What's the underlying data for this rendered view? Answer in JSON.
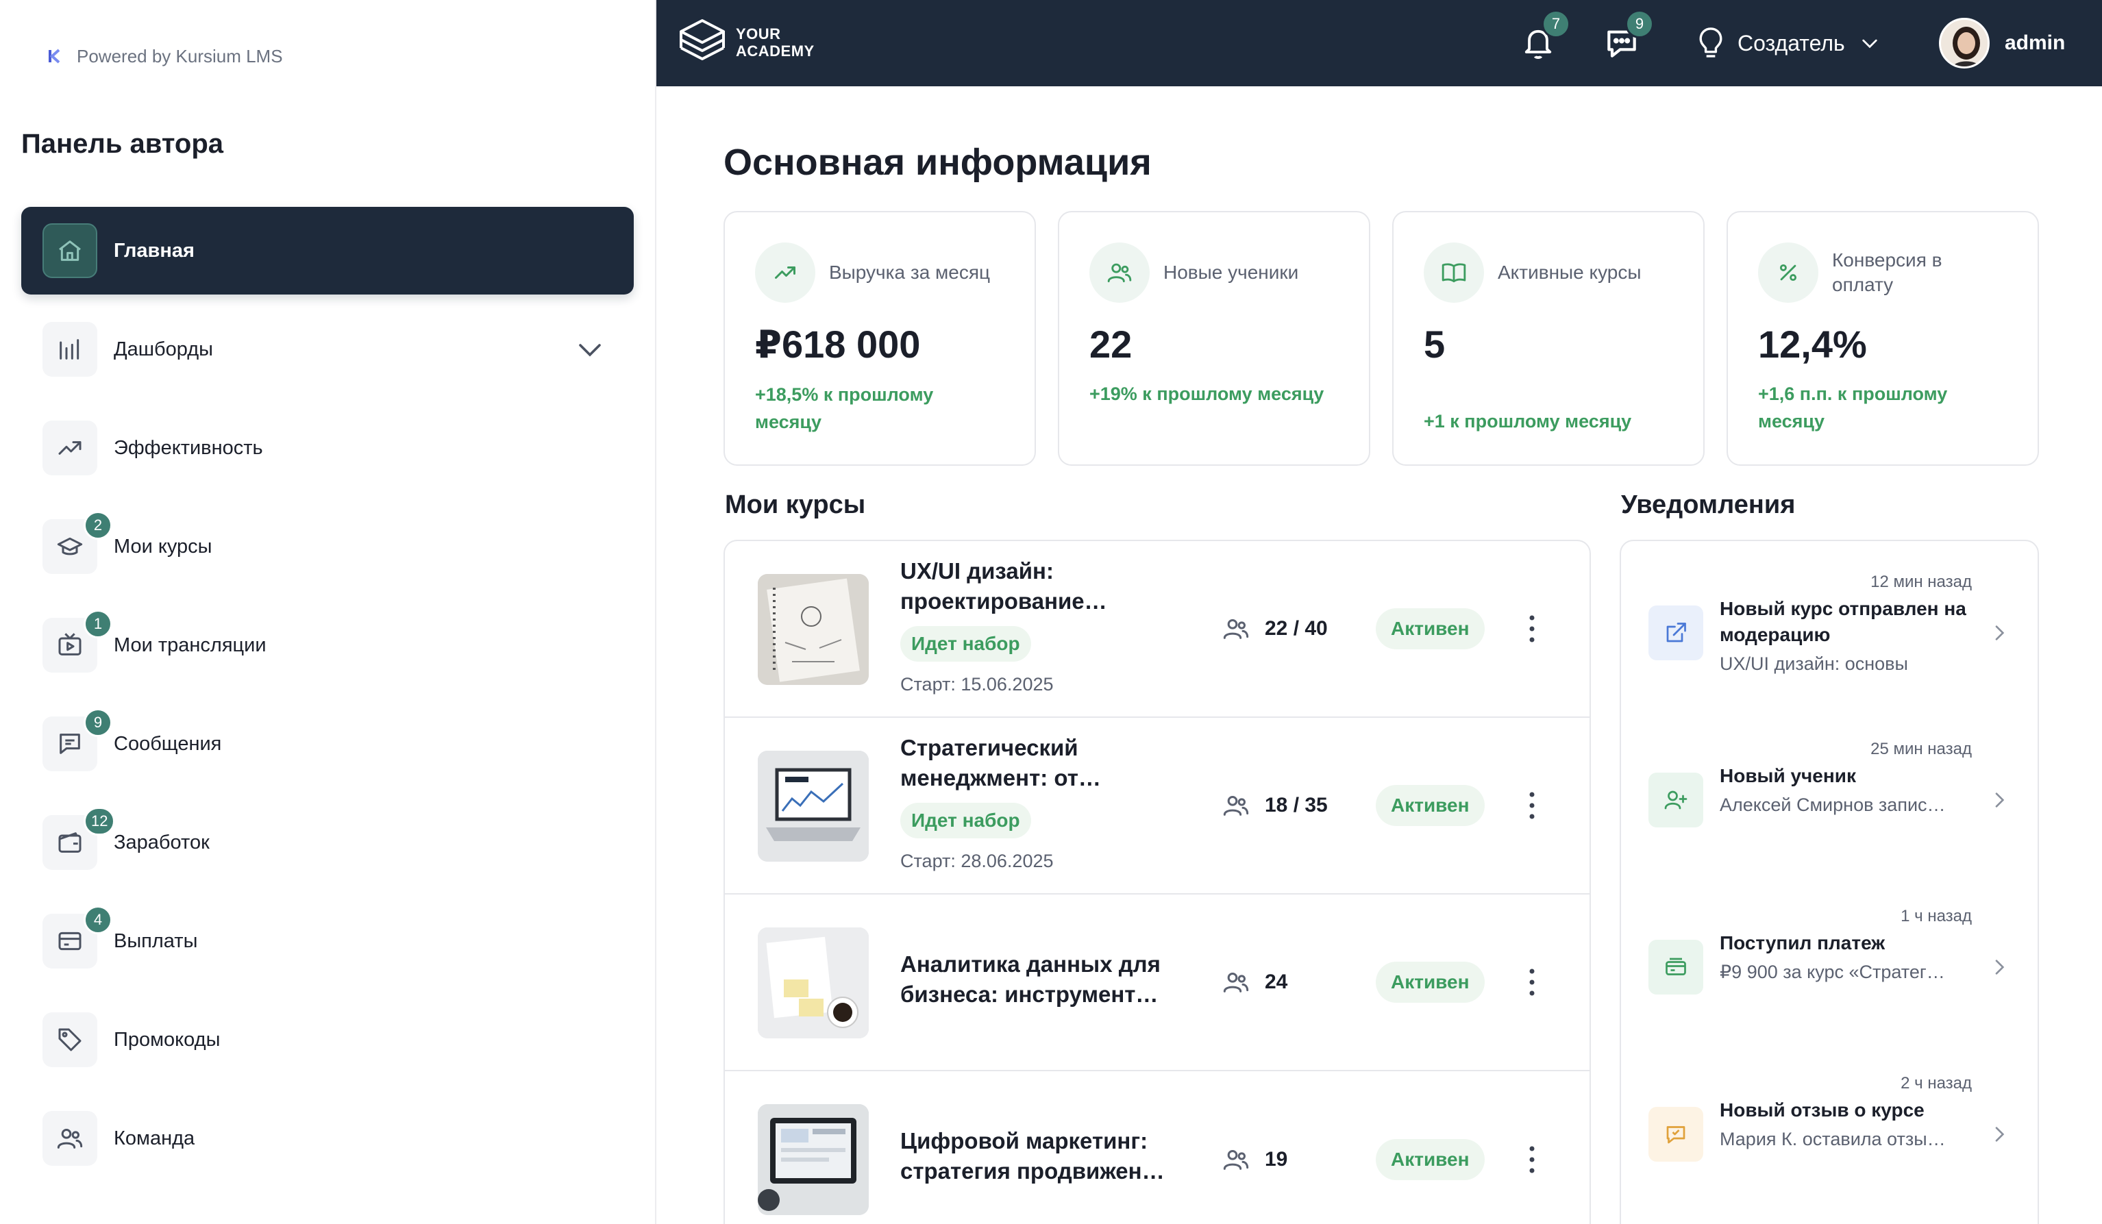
{
  "sidebar": {
    "powered_by": "Powered by Kursium LMS",
    "panel_title": "Панель автора",
    "items": [
      {
        "label": "Главная",
        "badge": ""
      },
      {
        "label": "Дашборды",
        "badge": ""
      },
      {
        "label": "Эффективность",
        "badge": ""
      },
      {
        "label": "Мои курсы",
        "badge": "2"
      },
      {
        "label": "Мои трансляции",
        "badge": "1"
      },
      {
        "label": "Сообщения",
        "badge": "9"
      },
      {
        "label": "Заработок",
        "badge": "12"
      },
      {
        "label": "Выплаты",
        "badge": "4"
      },
      {
        "label": "Промокоды",
        "badge": ""
      },
      {
        "label": "Команда",
        "badge": ""
      }
    ]
  },
  "topbar": {
    "brand_line1": "YOUR",
    "brand_line2": "ACADEMY",
    "notifications_count": "7",
    "messages_count": "9",
    "role": "Создатель",
    "username": "admin"
  },
  "main": {
    "title": "Основная информация",
    "stats": [
      {
        "label": "Выручка за месяц",
        "value": "₽618 000",
        "delta": "+18,5% к прошлому месяцу"
      },
      {
        "label": "Новые ученики",
        "value": "22",
        "delta": "+19% к прошлому месяцу"
      },
      {
        "label": "Активные курсы",
        "value": "5",
        "delta": "+1 к прошлому месяцу"
      },
      {
        "label": "Конверсия в оплату",
        "value": "12,4%",
        "delta": "+1,6 п.п. к прошлому месяцу"
      }
    ],
    "courses_title": "Мои курсы",
    "courses": [
      {
        "title": "UX/UI дизайн: проектирование…",
        "tag": "Идет набор",
        "start": "Старт: 15.06.2025",
        "students": "22 / 40",
        "status": "Активен"
      },
      {
        "title": "Стратегический менеджмент: от…",
        "tag": "Идет набор",
        "start": "Старт: 28.06.2025",
        "students": "18 / 35",
        "status": "Активен"
      },
      {
        "title": "Аналитика данных для бизнеса: инструмент…",
        "tag": "",
        "start": "",
        "students": "24",
        "status": "Активен"
      },
      {
        "title": "Цифровой маркетинг: стратегия продвижен…",
        "tag": "",
        "start": "",
        "students": "19",
        "status": "Активен"
      }
    ],
    "notifications_title": "Уведомления",
    "notifications": [
      {
        "time": "12 мин назад",
        "title": "Новый курс отправлен на модерацию",
        "subtitle": "UX/UI дизайн: основы",
        "color": "#eaf0fb"
      },
      {
        "time": "25 мин назад",
        "title": "Новый ученик",
        "subtitle": "Алексей Смирнов запис…",
        "color": "#eaf5ee"
      },
      {
        "time": "1 ч назад",
        "title": "Поступил платеж",
        "subtitle": "₽9 900 за курс «Стратег…",
        "color": "#eaf5ee"
      },
      {
        "time": "2 ч назад",
        "title": "Новый отзыв о курсе",
        "subtitle": "Мария К. оставила отзы…",
        "color": "#fdf3e4"
      }
    ]
  },
  "colors": {
    "dark_navy": "#1e2a3b",
    "accent_green": "#3c9c5f",
    "badge_teal": "#3f7f73"
  }
}
